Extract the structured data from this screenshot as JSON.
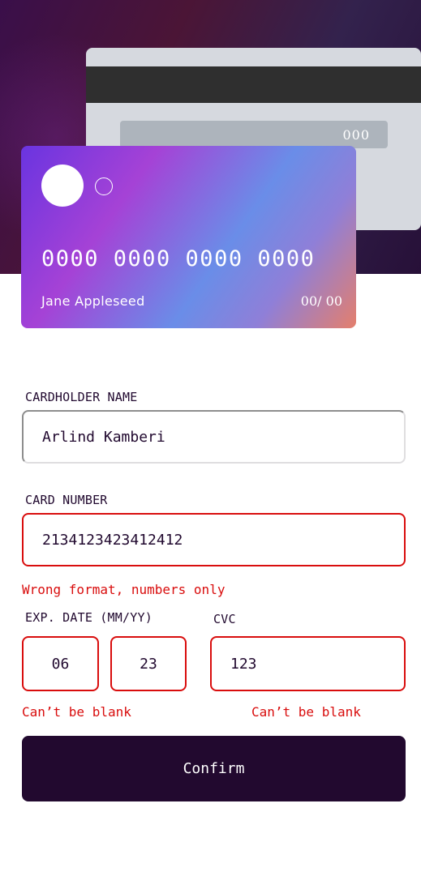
{
  "card_back": {
    "cvc": "000"
  },
  "card_front": {
    "number": "0000 0000 0000 0000",
    "holder": "Jane Appleseed",
    "expiry": "00/ 00"
  },
  "form": {
    "cardholder": {
      "label": "CARDHOLDER NAME",
      "value": "Arlind Kamberi"
    },
    "card_number": {
      "label": "CARD NUMBER",
      "value": "2134123423412412",
      "error": "Wrong format, numbers only"
    },
    "exp_date": {
      "label": "EXP. DATE (MM/YY)",
      "month": "06",
      "year": "23",
      "error": "Can’t be blank"
    },
    "cvc": {
      "label": "CVC",
      "value": "123",
      "error": "Can’t be blank"
    },
    "confirm_label": "Confirm"
  },
  "colors": {
    "accent_dark": "#22092f",
    "error": "#d90d0d",
    "border": "#dfdee0"
  }
}
